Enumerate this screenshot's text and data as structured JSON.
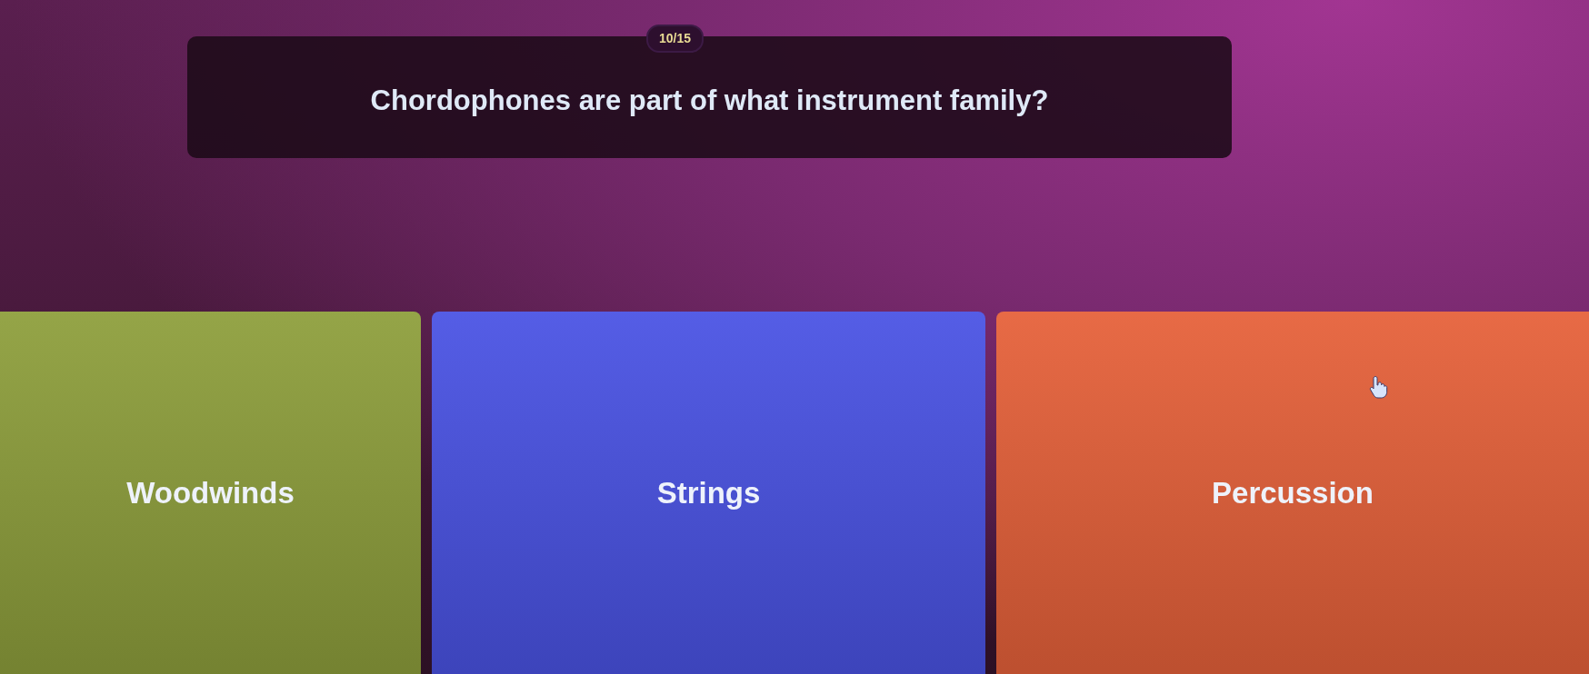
{
  "quiz": {
    "counter": "10/15",
    "question": "Chordophones are part of what instrument family?"
  },
  "options": [
    {
      "label": "Woodwinds",
      "color": "#8e9f3c"
    },
    {
      "label": "Strings",
      "color": "#4a53e4"
    },
    {
      "label": "Percussion",
      "color": "#e6613a"
    }
  ]
}
